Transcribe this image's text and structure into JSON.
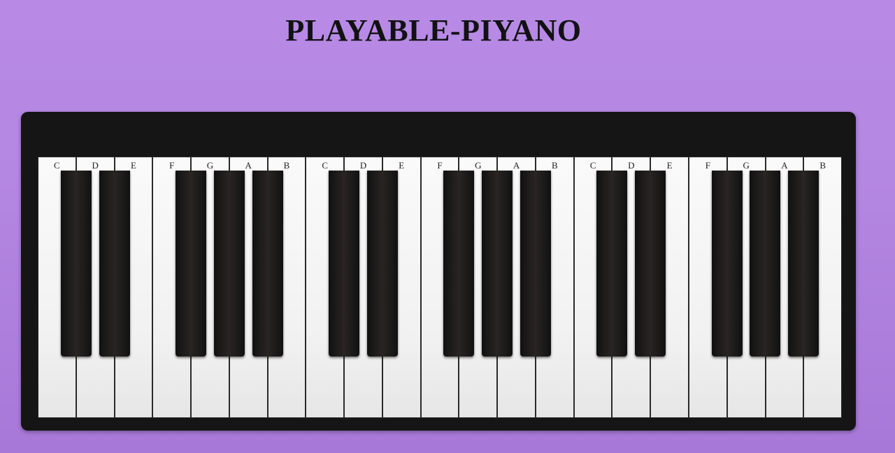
{
  "page": {
    "title": "PLAYABLE-PIYANO"
  },
  "piano": {
    "white_keys": [
      "C",
      "D",
      "E",
      "F",
      "G",
      "A",
      "B",
      "C",
      "D",
      "E",
      "F",
      "G",
      "A",
      "B",
      "C",
      "D",
      "E",
      "F",
      "G",
      "A",
      "B"
    ],
    "black_keys_after_white_index": [
      0,
      1,
      3,
      4,
      5,
      7,
      8,
      10,
      11,
      12,
      14,
      15,
      17,
      18,
      19
    ]
  }
}
